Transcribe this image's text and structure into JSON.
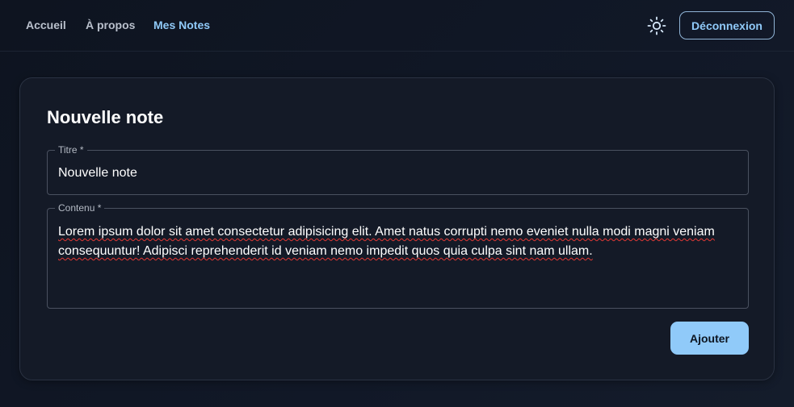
{
  "nav": {
    "items": [
      {
        "label": "Accueil",
        "active": false
      },
      {
        "label": "À propos",
        "active": false
      },
      {
        "label": "Mes Notes",
        "active": true
      }
    ],
    "theme_icon": "sun-icon",
    "logout_label": "Déconnexion"
  },
  "form": {
    "heading": "Nouvelle note",
    "title_field": {
      "label": "Titre *",
      "value": "Nouvelle note"
    },
    "content_field": {
      "label": "Contenu *",
      "value": "Lorem ipsum dolor sit amet consectetur adipisicing elit. Amet natus corrupti nemo eveniet nulla modi magni veniam consequuntur! Adipisci reprehenderit id veniam nemo impedit quos quia culpa sint nam ullam."
    },
    "submit_label": "Ajouter"
  },
  "colors": {
    "accent": "#90caf9",
    "background": "#111827",
    "card": "#141a27",
    "spellcheck": "#e53935"
  }
}
